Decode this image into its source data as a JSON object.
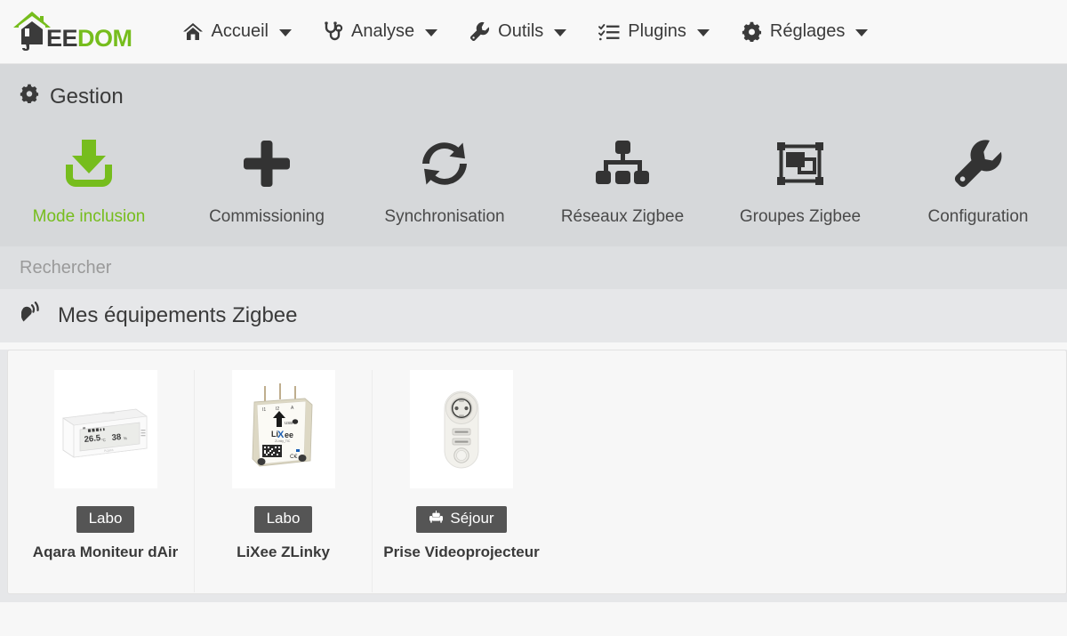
{
  "brand": {
    "ee": "EE",
    "dom": "DOM",
    "logo_icon": "jeedom-house-logo",
    "accent_green": "#76bd1d"
  },
  "navbar": {
    "items": [
      {
        "label": "Accueil",
        "icon": "home-icon",
        "caret": true
      },
      {
        "label": "Analyse",
        "icon": "stethoscope-icon",
        "caret": true
      },
      {
        "label": "Outils",
        "icon": "wrench-icon",
        "caret": true
      },
      {
        "label": "Plugins",
        "icon": "task-list-icon",
        "caret": true
      },
      {
        "label": "Réglages",
        "icon": "gear-icon",
        "caret": true
      }
    ]
  },
  "gestion": {
    "title": "Gestion",
    "title_icon": "gear-icon",
    "tools": [
      {
        "label": "Mode inclusion",
        "icon": "inbox-download-icon",
        "active": true,
        "color": "#76bd1d"
      },
      {
        "label": "Commissioning",
        "icon": "plus-icon",
        "active": false,
        "color": "#333333"
      },
      {
        "label": "Synchronisation",
        "icon": "sync-refresh-icon",
        "active": false,
        "color": "#333333"
      },
      {
        "label": "Réseaux Zigbee",
        "icon": "sitemap-icon",
        "active": false,
        "color": "#333333"
      },
      {
        "label": "Groupes Zigbee",
        "icon": "object-group-icon",
        "active": false,
        "color": "#333333"
      },
      {
        "label": "Configuration",
        "icon": "wrench-icon",
        "active": false,
        "color": "#333333"
      }
    ]
  },
  "search": {
    "value": "",
    "placeholder": "Rechercher",
    "name": "search-input"
  },
  "equipments_section": {
    "title": "Mes équipements Zigbee",
    "title_icon": "satellite-dish-icon",
    "cards": [
      {
        "name": "Aqara Moniteur dAir",
        "badge": "Labo",
        "badge_icon": null,
        "thumb": "aqara-air-monitor-photo"
      },
      {
        "name": "LiXee ZLinky",
        "badge": "Labo",
        "badge_icon": null,
        "thumb": "lixee-zlinky-module-photo"
      },
      {
        "name": "Prise Videoprojecteur",
        "badge": "Séjour",
        "badge_icon": "couch-icon",
        "thumb": "smart-plug-photo"
      }
    ]
  }
}
